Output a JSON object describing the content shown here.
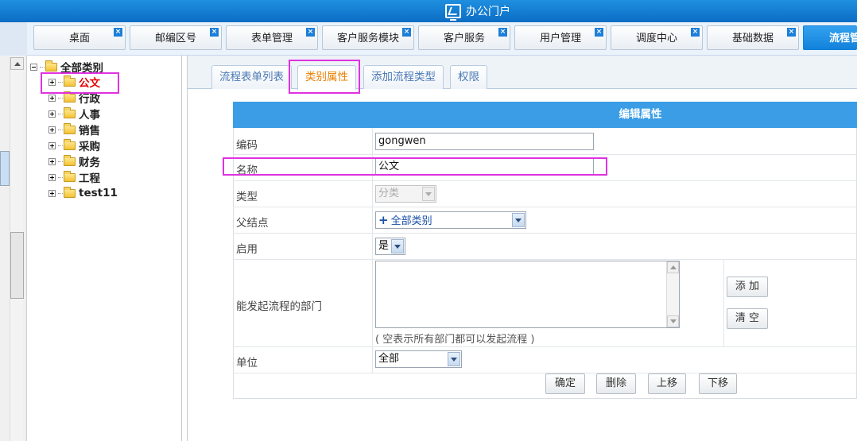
{
  "app": {
    "title": "办公门户"
  },
  "main_tabs": [
    {
      "label": "桌面",
      "close": "×"
    },
    {
      "label": "邮编区号",
      "close": "×"
    },
    {
      "label": "表单管理",
      "close": "×"
    },
    {
      "label": "客户服务模块",
      "close": "×"
    },
    {
      "label": "客户服务",
      "close": "×"
    },
    {
      "label": "用户管理",
      "close": "×"
    },
    {
      "label": "调度中心",
      "close": "×"
    },
    {
      "label": "基础数据",
      "close": "×"
    },
    {
      "label": "流程管",
      "active": true
    }
  ],
  "tree": {
    "root": "全部类别",
    "items": [
      {
        "label": "公文",
        "selected": true
      },
      {
        "label": "行政"
      },
      {
        "label": "人事"
      },
      {
        "label": "销售"
      },
      {
        "label": "采购"
      },
      {
        "label": "财务"
      },
      {
        "label": "工程"
      },
      {
        "label": "test11"
      }
    ]
  },
  "sub_tabs": [
    {
      "label": "流程表单列表"
    },
    {
      "label": "类别属性",
      "active": true
    },
    {
      "label": "添加流程类型"
    },
    {
      "label": "权限"
    }
  ],
  "form": {
    "header": "编辑属性",
    "code_label": "编码",
    "code_value": "gongwen",
    "name_label": "名称",
    "name_value": "公文",
    "type_label": "类型",
    "type_value": "分类",
    "parent_label": "父结点",
    "parent_value": "全部类别",
    "parent_plus": "+",
    "enabled_label": "启用",
    "enabled_value": "是",
    "dept_label": "能发起流程的部门",
    "dept_hint": "( 空表示所有部门都可以发起流程 )",
    "add_label": "添 加",
    "clear_label": "清 空",
    "unit_label": "单位",
    "unit_value": "全部",
    "buttons": {
      "confirm": "确定",
      "delete": "删除",
      "up": "上移",
      "down": "下移"
    }
  },
  "colors": {
    "accent": "#3a9de6",
    "highlight": "#e032e0",
    "selected_tree": "#e60000",
    "active_subtab": "#e87f00"
  }
}
